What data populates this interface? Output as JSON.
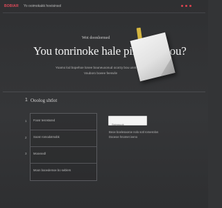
{
  "topbar": {
    "brand": "BOBIAR",
    "text": "Yo ooimokakk hovisinsol",
    "dots": [
      "dot-1",
      "dot-2",
      "dot-3"
    ]
  },
  "hero": {
    "overline": "Wot doonlormed",
    "title": "You tonrinoke hale pimnuet oou?",
    "subtitle_line1": "Yoamo lod bopehoe lonee bouneuxonud ocorzy bou unnt voeneeslar",
    "subtitle_line2": "Vouboro boeee feesvile"
  },
  "section": {
    "icon_text": "1",
    "title": "Ooolog shtlot"
  },
  "list": {
    "items": [
      {
        "num": "1",
        "label": "Foosr tesnstuted"
      },
      {
        "num": "2",
        "label": "Soosr romodotmobk"
      },
      {
        "num": "3",
        "label": "Moovsedl"
      },
      {
        "num": "",
        "label": "Moon booedemoe bo seblers"
      }
    ]
  },
  "side": {
    "input_value": "Ssimnuok",
    "text_line1": "Beoe boelesaoroe nolo sotl romesnlos",
    "text_line2": "Dooeoe hnomet iveno"
  },
  "colors": {
    "accent": "#e24a5a",
    "background": "#333436"
  }
}
